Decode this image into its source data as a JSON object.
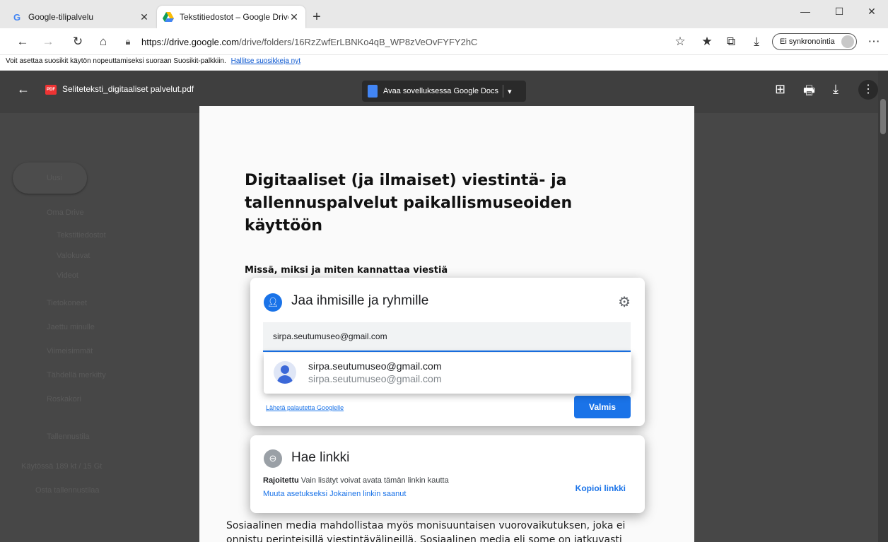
{
  "tabs": [
    {
      "favicon": "google-icon",
      "title": "Google-tilipalvelu"
    },
    {
      "favicon": "drive-icon",
      "title": "Tekstitiedostot – Google Drive"
    }
  ],
  "window_controls": {
    "minimize": "—",
    "maximize": "☐",
    "close": "✕"
  },
  "nav": {
    "url_host": "https://drive.google.com",
    "url_path": "/drive/folders/16RzZwfErLBNKo4qB_WP8zVeOvFYFY2hC",
    "sync_label": "Ei synkronointia"
  },
  "favbar": {
    "text": "Voit asettaa suosikit käytön nopeuttamiseksi suoraan Suosikit-palkkiin.",
    "link": "Hallitse suosikkeja nyt"
  },
  "drive_sidebar": {
    "new_label": "Uusi",
    "items": [
      "Oma Drive",
      "Tekstitiedostot",
      "Valokuvat",
      "Videot",
      "Tietokoneet",
      "Jaettu minulle",
      "Viimeisimmät",
      "Tähdellä merkitty",
      "Roskakori",
      "Tallennustila",
      "Käytössä 189 kt / 15 Gt",
      "Osta tallennustilaa"
    ]
  },
  "viewer": {
    "file_title": "Seliteteksti_digitaaliset palvelut.pdf",
    "open_with": "Avaa sovelluksessa Google Docs"
  },
  "pdf": {
    "heading": "Digitaaliset (ja ilmaiset) viestintä- ja tallennuspalvelut paikallismuseoiden käyttöön",
    "subheading": "Missä, miksi ja miten kannattaa viestiä",
    "body": "Sosiaalinen media mahdollistaa myös monisuuntaisen vuorovaikutuksen, joka ei onnistu perinteisillä viestintävälineillä. Sosiaalinen media eli some on jatkuvasti"
  },
  "share_dialog": {
    "title": "Jaa ihmisille ja ryhmille",
    "input_value": "sirpa.seutumuseo@gmail.com",
    "suggestion_name": "sirpa.seutumuseo@gmail.com",
    "suggestion_email": "sirpa.seutumuseo@gmail.com",
    "feedback": "Lähetä palautetta Googlelle",
    "done": "Valmis"
  },
  "link_dialog": {
    "title": "Hae linkki",
    "restricted_label": "Rajoitettu",
    "restricted_text": "Vain lisätyt voivat avata tämän linkin kautta",
    "change": "Muuta asetukseksi Jokainen linkin saanut",
    "copy": "Kopioi linkki"
  },
  "colors": {
    "accent": "#1a73e8"
  }
}
